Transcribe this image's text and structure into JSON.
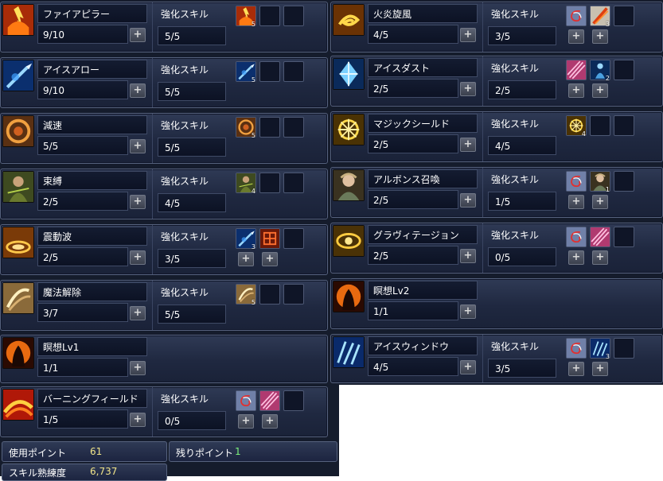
{
  "enhance_label": "強化スキル",
  "skills_left": [
    {
      "name": "ファイアピラー",
      "level": "9/10",
      "enhance": "5/5",
      "icon": "fire-pillar-icon",
      "enh_slots": [
        {
          "icon": "fire-pillar-icon",
          "count": "5"
        }
      ]
    },
    {
      "name": "アイスアロー",
      "level": "9/10",
      "enhance": "5/5",
      "icon": "ice-arrow-icon",
      "enh_slots": [
        {
          "icon": "ice-arrow-icon",
          "count": "5"
        }
      ]
    },
    {
      "name": "減速",
      "level": "5/5",
      "enhance": "5/5",
      "icon": "slow-icon",
      "enh_slots": [
        {
          "icon": "slow-icon",
          "count": "5"
        }
      ]
    },
    {
      "name": "束縛",
      "level": "2/5",
      "enhance": "4/5",
      "icon": "bind-icon",
      "enh_slots": [
        {
          "icon": "bind-icon",
          "count": "4"
        }
      ]
    },
    {
      "name": "震動波",
      "level": "2/5",
      "enhance": "3/5",
      "icon": "shockwave-icon",
      "enh_slots": [
        {
          "icon": "ice-arrow-icon",
          "count": "3"
        },
        {
          "icon": "flame-grid-icon",
          "count": ""
        }
      ]
    },
    {
      "name": "魔法解除",
      "level": "3/7",
      "enhance": "5/5",
      "icon": "dispel-icon",
      "enh_slots": [
        {
          "icon": "dispel-icon",
          "count": "5"
        }
      ]
    },
    {
      "name": "瞑想Lv1",
      "level": "1/1",
      "icon": "meditation-icon",
      "enh_slots": []
    },
    {
      "name": "バーニングフィールド",
      "level": "1/5",
      "enhance": "0/5",
      "icon": "burning-field-icon",
      "enh_slots": [
        {
          "icon": "swirl-icon",
          "count": ""
        },
        {
          "icon": "pink-crystal-icon",
          "count": ""
        }
      ]
    }
  ],
  "skills_right": [
    {
      "name": "火炎旋風",
      "level": "4/5",
      "enhance": "3/5",
      "icon": "fire-whirl-icon",
      "enh_slots": [
        {
          "icon": "swirl-icon",
          "count": ""
        },
        {
          "icon": "flame-slash-icon",
          "count": "3"
        }
      ]
    },
    {
      "name": "アイスダスト",
      "level": "2/5",
      "enhance": "2/5",
      "icon": "ice-dust-icon",
      "enh_slots": [
        {
          "icon": "pink-crystal-icon",
          "count": ""
        },
        {
          "icon": "ice-figure-icon",
          "count": "2"
        }
      ]
    },
    {
      "name": "マジックシールド",
      "level": "2/5",
      "enhance": "4/5",
      "icon": "magic-shield-icon",
      "enh_slots": [
        {
          "icon": "magic-shield-icon",
          "count": "4"
        }
      ]
    },
    {
      "name": "アルボンス召喚",
      "level": "2/5",
      "enhance": "1/5",
      "icon": "summon-icon",
      "enh_slots": [
        {
          "icon": "swirl-icon",
          "count": ""
        },
        {
          "icon": "summon-icon",
          "count": "1"
        }
      ]
    },
    {
      "name": "グラヴィテージョン",
      "level": "2/5",
      "enhance": "0/5",
      "icon": "gravitation-icon",
      "enh_slots": [
        {
          "icon": "swirl-icon",
          "count": ""
        },
        {
          "icon": "pink-crystal-icon",
          "count": ""
        }
      ]
    },
    {
      "name": "瞑想Lv2",
      "level": "1/1",
      "icon": "meditation-icon",
      "enh_slots": []
    },
    {
      "name": "アイスウィンドウ",
      "level": "4/5",
      "enhance": "3/5",
      "icon": "ice-window-icon",
      "enh_slots": [
        {
          "icon": "swirl-icon",
          "count": ""
        },
        {
          "icon": "ice-window-icon",
          "count": "3"
        }
      ]
    }
  ],
  "status": {
    "used_label": "使用ポイント",
    "used_value": "61",
    "remain_label": "残りポイント",
    "remain_value": "1",
    "mastery_label": "スキル熟練度",
    "mastery_value": "6,737"
  },
  "colors": {
    "used_value": "#f0e48a",
    "remain_value": "#7cf07c",
    "mastery_value": "#f0e48a"
  }
}
